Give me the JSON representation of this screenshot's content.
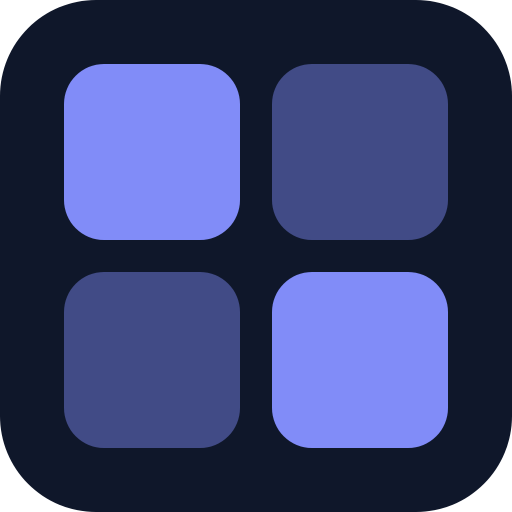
{
  "icon": {
    "name": "grid-icon",
    "colors": {
      "background": "#0f172a",
      "tile_bright": "#818cf8",
      "tile_dim": "#414b86"
    },
    "tiles": [
      {
        "name": "tile-top-left",
        "tone": "tile_bright"
      },
      {
        "name": "tile-top-right",
        "tone": "tile_dim"
      },
      {
        "name": "tile-bottom-left",
        "tone": "tile_dim"
      },
      {
        "name": "tile-bottom-right",
        "tone": "tile_bright"
      }
    ]
  }
}
